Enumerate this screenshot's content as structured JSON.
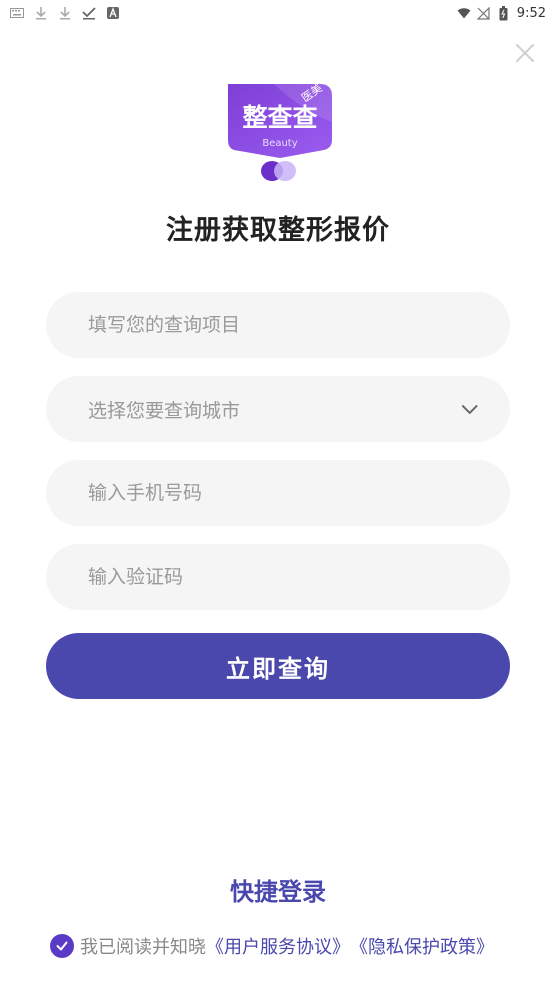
{
  "status_bar": {
    "time": "9:52",
    "left_icons": [
      "keyboard-icon",
      "download-icon",
      "download-icon",
      "checkmark-icon",
      "app-a-icon"
    ],
    "right_icons": [
      "wifi-icon",
      "no-signal-icon",
      "battery-icon"
    ]
  },
  "logo": {
    "main_text": "整查查",
    "tag_text": "医美",
    "sub_text": "Beauty",
    "colors": {
      "primary": "#7e3fd6",
      "secondary": "#b388ff"
    }
  },
  "title": "注册获取整形报价",
  "form": {
    "query_placeholder": "填写您的查询项目",
    "city_placeholder": "选择您要查询城市",
    "phone_placeholder": "输入手机号码",
    "code_placeholder": "输入验证码",
    "submit_label": "立即查询"
  },
  "quick_login_label": "快捷登录",
  "agreement": {
    "prefix": "我已阅读并知晓",
    "user_agreement": "《用户服务协议》",
    "privacy_policy": "《隐私保护政策》",
    "checked": true
  },
  "colors": {
    "accent": "#4a48ac",
    "check": "#5b3bc5",
    "field_bg": "#f5f5f5"
  }
}
